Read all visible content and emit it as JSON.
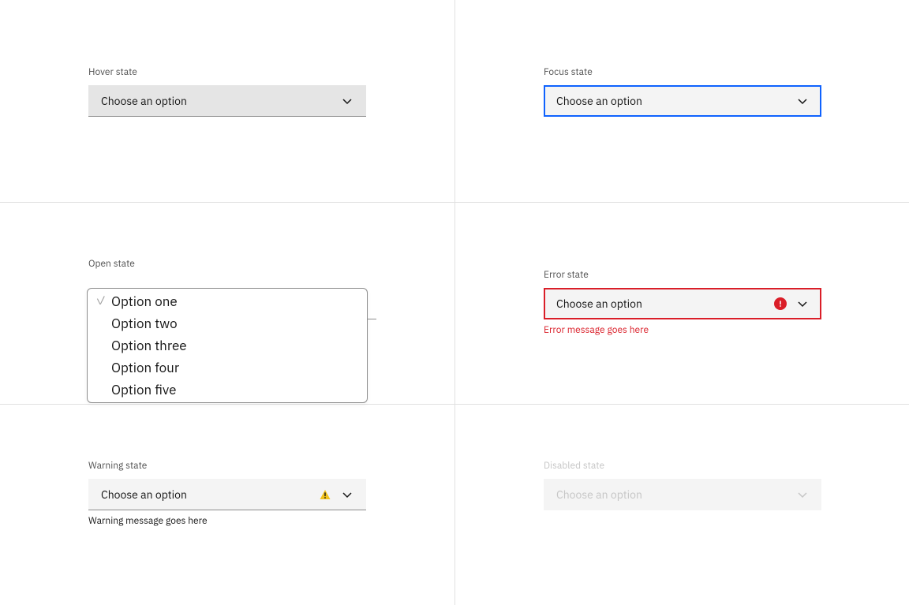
{
  "hover": {
    "label": "Hover state",
    "placeholder": "Choose an option"
  },
  "focus": {
    "label": "Focus state",
    "placeholder": "Choose an option"
  },
  "open": {
    "label": "Open state",
    "options": [
      "Option one",
      "Option two",
      "Option three",
      "Option four",
      "Option five"
    ]
  },
  "error": {
    "label": "Error state",
    "placeholder": "Choose an option",
    "message": "Error message goes here"
  },
  "warning": {
    "label": "Warning state",
    "placeholder": "Choose an option",
    "message": "Warning message goes here"
  },
  "disabled": {
    "label": "Disabled state",
    "placeholder": "Choose an option"
  }
}
